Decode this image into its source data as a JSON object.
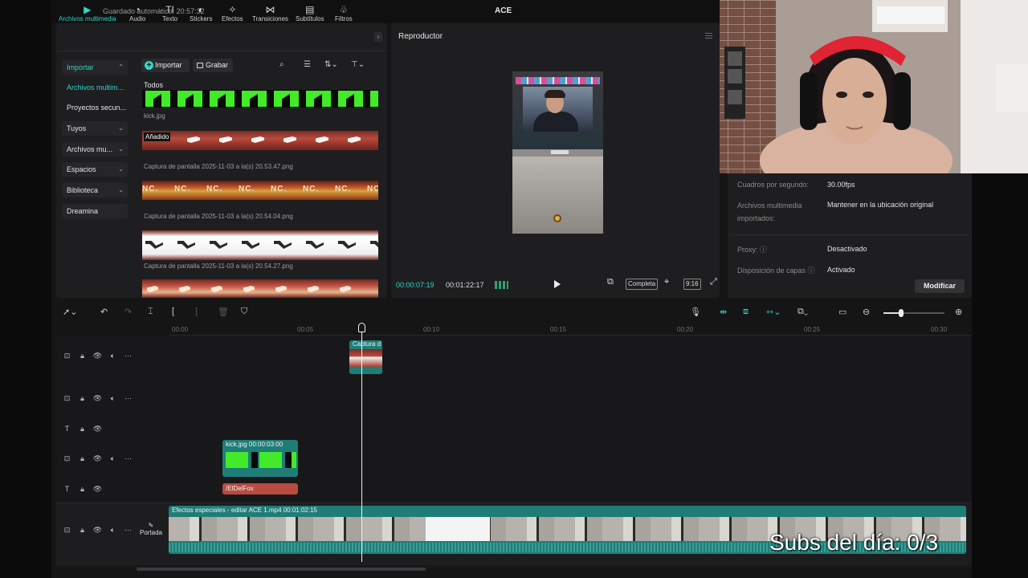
{
  "titlebar": {
    "autosave": "Guardado automático: 20:57:32",
    "title": "ACE"
  },
  "media_tabs": [
    {
      "label": "Archivos multimedia",
      "icon": "media-icon",
      "glyph": "▶"
    },
    {
      "label": "Audio",
      "icon": "audio-icon",
      "glyph": "◔"
    },
    {
      "label": "Texto",
      "icon": "text-icon",
      "glyph": "TI"
    },
    {
      "label": "Stickers",
      "icon": "sticker-icon",
      "glyph": "◐"
    },
    {
      "label": "Efectos",
      "icon": "effects-icon",
      "glyph": "✧"
    },
    {
      "label": "Transiciones",
      "icon": "transition-icon",
      "glyph": "⋈"
    },
    {
      "label": "Subtítulos",
      "icon": "subtitle-icon",
      "glyph": "▤"
    },
    {
      "label": "Filtros",
      "icon": "filter-icon",
      "glyph": "♧"
    }
  ],
  "sidebar": {
    "importar": "Importar",
    "archivos": "Archivos multim...",
    "proyectos": "Proyectos secun...",
    "tuyos": "Tuyos",
    "archivos_mu": "Archivos mu...",
    "espacios": "Espacios",
    "biblioteca": "Biblioteca",
    "dreamina": "Dreamina"
  },
  "media_toolbar": {
    "import": "Importar",
    "record": "Grabar"
  },
  "media": {
    "section": "Todos",
    "added_badge": "Añadido",
    "files": [
      "kick.jpg",
      "Captura de pantalla 2025-11-03 a la(s) 20.53.47.png",
      "Captura de pantalla 2025-11-03 a la(s) 20.54.04.png",
      "Captura de pantalla 2025-11-03 a la(s) 20.54.27.png"
    ],
    "strip_text": "NC."
  },
  "player": {
    "title": "Reproductor",
    "current_time": "00:00:07:19",
    "total_time": "00:01:22:17",
    "quality": "Completa",
    "ratio": "9:16"
  },
  "properties": {
    "fps_label": "Cuadros por segundo:",
    "fps_value": "30.00fps",
    "media_label_1": "Archivos multimedia",
    "media_label_2": "importados:",
    "media_value": "Mantener en la ubicación original",
    "proxy_label": "Proxy: ⓘ",
    "proxy_value": "Desactivado",
    "layers_label": "Disposición de capas ⓘ",
    "layers_value": "Activado",
    "modify_button": "Modificar"
  },
  "ruler": [
    "00:00",
    "00:05",
    "00:10",
    "00:15",
    "00:20",
    "00:25",
    "00:30"
  ],
  "clips": {
    "capture_label": "Captura d",
    "kick_label": "kick.jpg   00:00:03:00",
    "text_label": "/ElDelFox",
    "main_label": "Efectos especiales - editar   ACE 1.mp4   00:01:02:15"
  },
  "portada": "Portada",
  "overlay": {
    "subs": "Subs del día: 0/3"
  },
  "colors": {
    "accent": "#2fd7c7",
    "panel": "#1e1e20",
    "clip_teal": "#1f7d78",
    "text_clip": "#b84b3f"
  }
}
